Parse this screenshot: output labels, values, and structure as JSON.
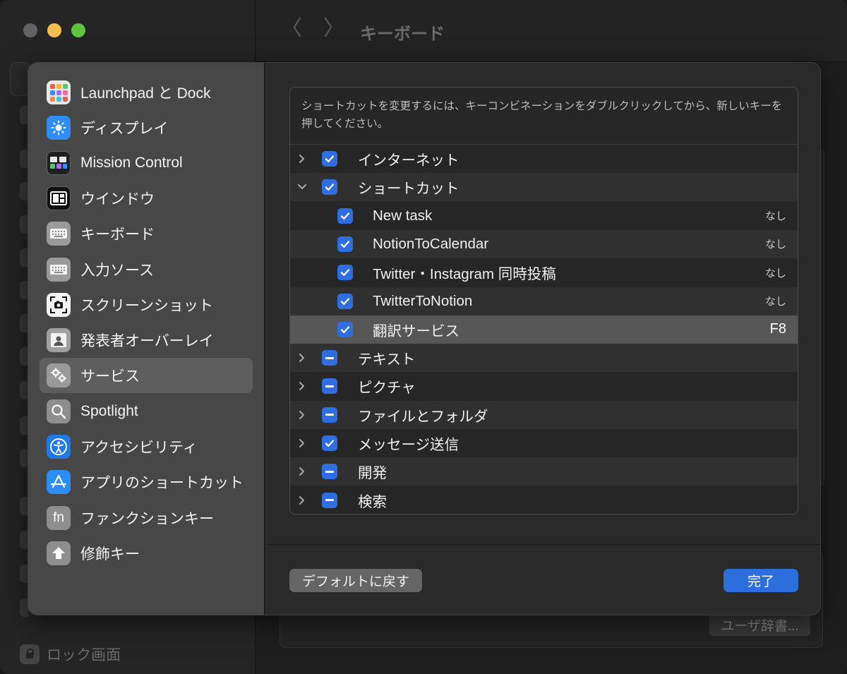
{
  "window": {
    "title": "キーボード",
    "back_glyph": "〈",
    "forward_glyph": "〉",
    "lock_label": "ロック画面",
    "user_dict_button": "ユーザ辞書..."
  },
  "sidebar": {
    "items": [
      {
        "label": "Launchpad と Dock",
        "icon": "launchpad-icon"
      },
      {
        "label": "ディスプレイ",
        "icon": "display-icon"
      },
      {
        "label": "Mission Control",
        "icon": "mission-control-icon"
      },
      {
        "label": "ウインドウ",
        "icon": "window-icon"
      },
      {
        "label": "キーボード",
        "icon": "keyboard-icon"
      },
      {
        "label": "入力ソース",
        "icon": "input-source-icon"
      },
      {
        "label": "スクリーンショット",
        "icon": "screenshot-icon"
      },
      {
        "label": "発表者オーバーレイ",
        "icon": "presenter-overlay-icon"
      },
      {
        "label": "サービス",
        "icon": "services-icon",
        "selected": true
      },
      {
        "label": "Spotlight",
        "icon": "spotlight-icon"
      },
      {
        "label": "アクセシビリティ",
        "icon": "accessibility-icon"
      },
      {
        "label": "アプリのショートカット",
        "icon": "app-shortcuts-icon"
      },
      {
        "label": "ファンクションキー",
        "icon": "fn-icon",
        "glyph": "fn"
      },
      {
        "label": "修飾キー",
        "icon": "modifier-keys-icon"
      }
    ]
  },
  "panel": {
    "description": "ショートカットを変更するには、キーコンビネーションをダブルクリックしてから、新しいキーを押してください。",
    "rows": [
      {
        "label": "インターネット",
        "state": "checked",
        "expand": "collapsed",
        "level": 0,
        "key": ""
      },
      {
        "label": "ショートカット",
        "state": "checked",
        "expand": "expanded",
        "level": 0,
        "key": ""
      },
      {
        "label": "New task",
        "state": "checked",
        "expand": "none",
        "level": 1,
        "key": "なし"
      },
      {
        "label": "NotionToCalendar",
        "state": "checked",
        "expand": "none",
        "level": 1,
        "key": "なし"
      },
      {
        "label": "Twitter・Instagram 同時投稿",
        "state": "checked",
        "expand": "none",
        "level": 1,
        "key": "なし"
      },
      {
        "label": "TwitterToNotion",
        "state": "checked",
        "expand": "none",
        "level": 1,
        "key": "なし"
      },
      {
        "label": "翻訳サービス",
        "state": "checked",
        "expand": "none",
        "level": 1,
        "key": "F8",
        "selected": true
      },
      {
        "label": "テキスト",
        "state": "mixed",
        "expand": "collapsed",
        "level": 0,
        "key": ""
      },
      {
        "label": "ピクチャ",
        "state": "mixed",
        "expand": "collapsed",
        "level": 0,
        "key": ""
      },
      {
        "label": "ファイルとフォルダ",
        "state": "mixed",
        "expand": "collapsed",
        "level": 0,
        "key": ""
      },
      {
        "label": "メッセージ送信",
        "state": "checked",
        "expand": "collapsed",
        "level": 0,
        "key": ""
      },
      {
        "label": "開発",
        "state": "mixed",
        "expand": "collapsed",
        "level": 0,
        "key": ""
      },
      {
        "label": "検索",
        "state": "mixed",
        "expand": "collapsed",
        "level": 0,
        "key": ""
      }
    ]
  },
  "buttons": {
    "restore_defaults": "デフォルトに戻す",
    "done": "完了"
  },
  "colors": {
    "accent": "#2c6fdc",
    "checkbox": "#2f6ee0",
    "close": "#626262",
    "minimize": "#f6bd4f",
    "maximize": "#5fc43d"
  }
}
